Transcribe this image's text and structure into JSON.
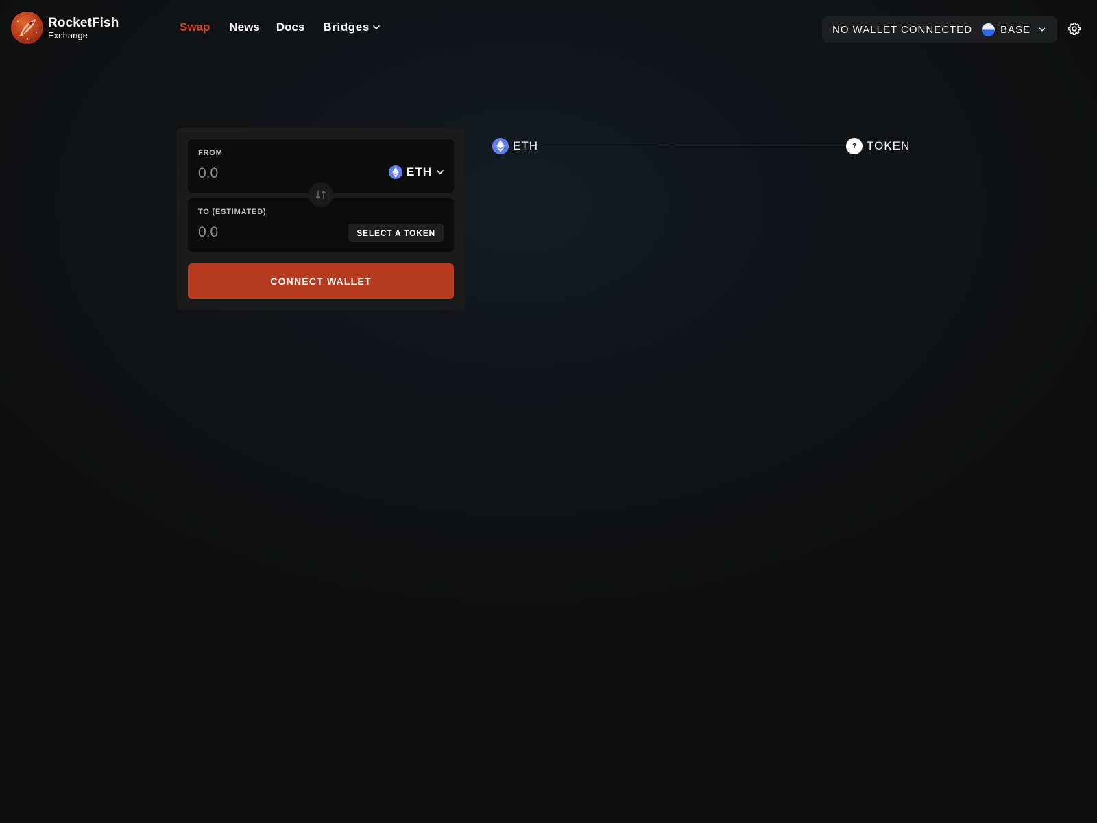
{
  "brand": {
    "name": "RocketFish",
    "subtitle": "Exchange",
    "logo_icon": "rocket-fish-logo",
    "accent_color": "#d5432a"
  },
  "nav": {
    "items": [
      {
        "label": "Swap",
        "active": true
      },
      {
        "label": "News",
        "active": false
      },
      {
        "label": "Docs",
        "active": false
      }
    ],
    "bridges_label": "Bridges"
  },
  "wallet": {
    "status": "NO WALLET CONNECTED",
    "network_label": "BASE",
    "network_icon": "base-network-icon"
  },
  "swap": {
    "from": {
      "label": "FROM",
      "placeholder": "0.0",
      "token": "ETH",
      "token_icon": "eth-icon"
    },
    "to": {
      "label": "TO (ESTIMATED)",
      "placeholder": "0.0",
      "select_label": "SELECT A TOKEN"
    },
    "flip_icon": "swap-arrows-icon",
    "connect_label": "CONNECT WALLET",
    "connect_color": "#b73b20"
  },
  "route": {
    "from_token": "ETH",
    "to_token": "TOKEN",
    "unknown_token_glyph": "?"
  }
}
